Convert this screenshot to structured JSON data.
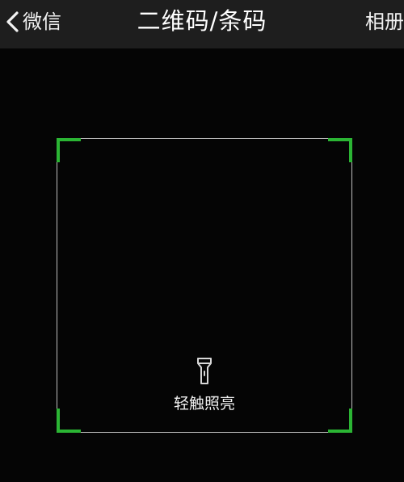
{
  "topbar": {
    "back_label": "微信",
    "title": "二维码/条码",
    "album_label": "相册"
  },
  "scanner": {
    "torch_label": "轻触照亮",
    "accent_color": "#2bb534"
  },
  "icons": {
    "back": "chevron-left-icon",
    "torch": "flashlight-icon"
  }
}
